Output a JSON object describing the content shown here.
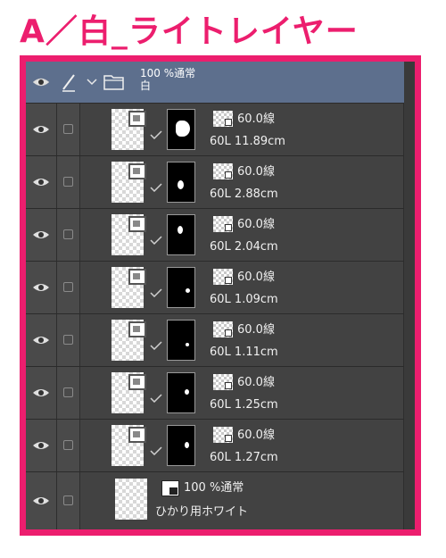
{
  "title": "A／白_ライトレイヤー",
  "accent_color": "#ec1e6e",
  "folder": {
    "opacity_blend": "100 %通常",
    "name": "白"
  },
  "layers": [
    {
      "line_info": "60.0線",
      "name": "60L 11.89cm"
    },
    {
      "line_info": "60.0線",
      "name": "60L 2.88cm"
    },
    {
      "line_info": "60.0線",
      "name": "60L 2.04cm"
    },
    {
      "line_info": "60.0線",
      "name": "60L 1.09cm"
    },
    {
      "line_info": "60.0線",
      "name": "60L 1.11cm"
    },
    {
      "line_info": "60.0線",
      "name": "60L 1.25cm"
    },
    {
      "line_info": "60.0線",
      "name": "60L 1.27cm"
    }
  ],
  "last_layer": {
    "opacity_blend": "100 %通常",
    "name": "ひかり用ホワイト"
  },
  "icons": {
    "visibility": "eye-icon",
    "pen": "pen-icon",
    "folder": "folder-icon",
    "raster": "raster-layer-icon",
    "link": "check-link-icon",
    "mask": "layer-mask",
    "line": "line-halftone-icon"
  }
}
